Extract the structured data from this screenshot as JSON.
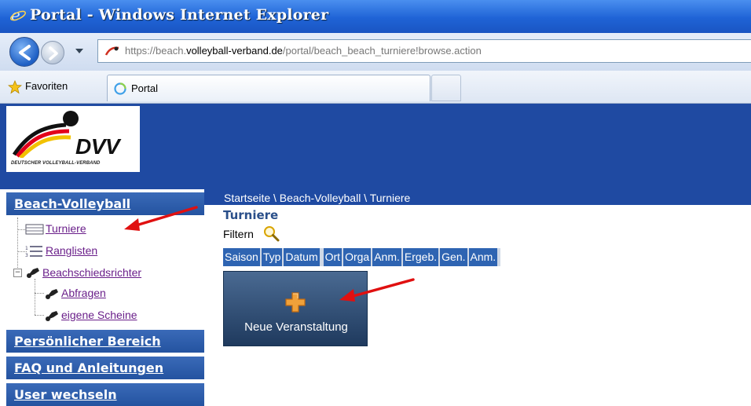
{
  "browser": {
    "title": "Portal - Windows Internet Explorer",
    "url_prefix": "https://beach.",
    "url_domain": "volleyball-verband.de",
    "url_path": "/portal/beach_beach_turniere!browse.action",
    "favorites_label": "Favoriten",
    "tab_label": "Portal"
  },
  "logo": {
    "text": "DVV",
    "subtitle": "DEUTSCHER VOLLEYBALL-VERBAND"
  },
  "sidebar": {
    "section_beach": "Beach-Volleyball",
    "items": [
      {
        "label": "Turniere"
      },
      {
        "label": "Ranglisten"
      },
      {
        "label": "Beachschiedsrichter"
      },
      {
        "label": "Abfragen"
      },
      {
        "label": "eigene Scheine"
      }
    ],
    "sections": [
      "Persönlicher Bereich",
      "FAQ und Anleitungen",
      "User wechseln"
    ]
  },
  "main": {
    "breadcrumb": "Startseite \\ Beach-Volleyball \\ Turniere",
    "title": "Turniere",
    "filter_label": "Filtern",
    "columns": [
      "Saison",
      "Typ",
      "Datum",
      "Ort",
      "Orga",
      "Anm.",
      "Ergeb.",
      "Gen.",
      "Anm."
    ],
    "new_event_label": "Neue Veranstaltung"
  },
  "colors": {
    "header_blue": "#1f4aa2",
    "annotation_arrow": "#e01010"
  }
}
